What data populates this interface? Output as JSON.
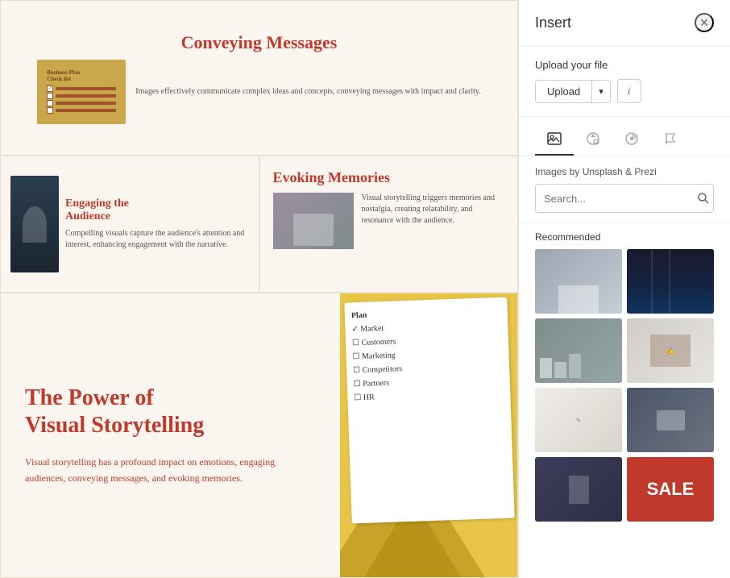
{
  "presentation": {
    "slides": [
      {
        "id": "slide-1",
        "title": "Conveying Messages",
        "text": "Images effectively communicate complex ideas and concepts, conveying messages with impact and clarity."
      },
      {
        "id": "slide-2",
        "title": "Engaging the\nAudience",
        "text": "Compelling visuals capture the audience's attention and interest, enhancing engagement with the narrative."
      },
      {
        "id": "slide-3",
        "title": "Evoking Memories",
        "text": "Visual storytelling triggers memories and nostalgia, creating relatability, and resonance with the audience."
      },
      {
        "id": "slide-4",
        "main_title": "The Power of\nVisual Storytelling",
        "subtitle": "Visual storytelling has a profound impact\non emotions, engaging audiences,\nconveying messages, and evoking\nmemories."
      }
    ]
  },
  "sidebar": {
    "title": "Insert",
    "close_icon": "×",
    "upload_section": {
      "label": "Upload your file",
      "upload_button": "Upload",
      "arrow_button": "▾",
      "info_button": "i"
    },
    "icon_tabs": [
      {
        "id": "images",
        "icon": "🖼",
        "active": true
      },
      {
        "id": "shapes",
        "icon": "⚙",
        "active": false
      },
      {
        "id": "stickers",
        "icon": "🏷",
        "active": false
      },
      {
        "id": "flags",
        "icon": "🚩",
        "active": false
      }
    ],
    "search": {
      "label": "Images by Unsplash & Prezi",
      "placeholder": "Search...",
      "button_icon": "🔍"
    },
    "recommended": {
      "label": "Recommended",
      "images": [
        {
          "id": "img-1",
          "style": "t1",
          "alt": "Person at desk"
        },
        {
          "id": "img-2",
          "style": "t2",
          "alt": "Dark corridor"
        },
        {
          "id": "img-3",
          "style": "t3",
          "alt": "Meeting room"
        },
        {
          "id": "img-4",
          "style": "t4",
          "alt": "Whiteboard writing"
        },
        {
          "id": "img-5",
          "style": "t5",
          "alt": "Drawing on paper"
        },
        {
          "id": "img-6",
          "style": "t6",
          "alt": "Person with laptop"
        },
        {
          "id": "img-7",
          "style": "t7",
          "alt": "Person with tablet"
        },
        {
          "id": "img-8",
          "style": "t8",
          "alt": "SALE sign"
        }
      ]
    }
  }
}
